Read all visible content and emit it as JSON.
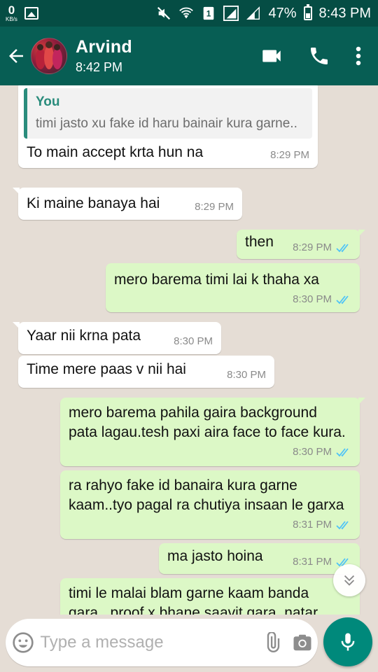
{
  "status_bar": {
    "net_speed_value": "0",
    "net_speed_unit": "KB/s",
    "battery": "47%",
    "time": "8:43 PM"
  },
  "header": {
    "contact_name": "Arvind",
    "last_seen": "8:42 PM",
    "icons": [
      "back-arrow-icon",
      "video-call-icon",
      "voice-call-icon",
      "more-options-icon"
    ]
  },
  "messages": [
    {
      "direction": "in",
      "quote_author": "You",
      "quote_text": "timi jasto xu fake id haru bainair kura garne..",
      "text": "To main accept krta hun na",
      "time": "8:29 PM"
    },
    {
      "direction": "in",
      "text": "Ki maine banaya hai",
      "time": "8:29 PM"
    },
    {
      "direction": "out",
      "text": "then",
      "time": "8:29 PM",
      "status": "read"
    },
    {
      "direction": "out",
      "text": "mero barema timi lai k thaha xa",
      "time": "8:30 PM",
      "status": "read"
    },
    {
      "direction": "in",
      "text": "Yaar nii krna pata",
      "time": "8:30 PM"
    },
    {
      "direction": "in",
      "text": "Time mere paas v nii hai",
      "time": "8:30 PM"
    },
    {
      "direction": "out",
      "text": "mero barema pahila gaira background pata lagau.tesh paxi aira face to face kura.",
      "time": "8:30 PM",
      "status": "read"
    },
    {
      "direction": "out",
      "text": "ra rahyo fake id banaira kura garne kaam..tyo pagal ra chutiya insaan le garxa",
      "time": "8:31 PM",
      "status": "read"
    },
    {
      "direction": "out",
      "text": "ma jasto hoina",
      "time": "8:31 PM",
      "status": "read"
    },
    {
      "direction": "out",
      "text": "timi le malai blam garne kaam banda gara...proof x bhane saavit gara..natar",
      "time": "",
      "status": "read"
    }
  ],
  "composer": {
    "placeholder": "Type a message"
  },
  "colors": {
    "header": "#075e54",
    "status_bar": "#054d44",
    "outgoing_bubble": "#dcf8c6",
    "incoming_bubble": "#ffffff",
    "read_tick": "#4fc3f7",
    "mic_button": "#00897b"
  }
}
